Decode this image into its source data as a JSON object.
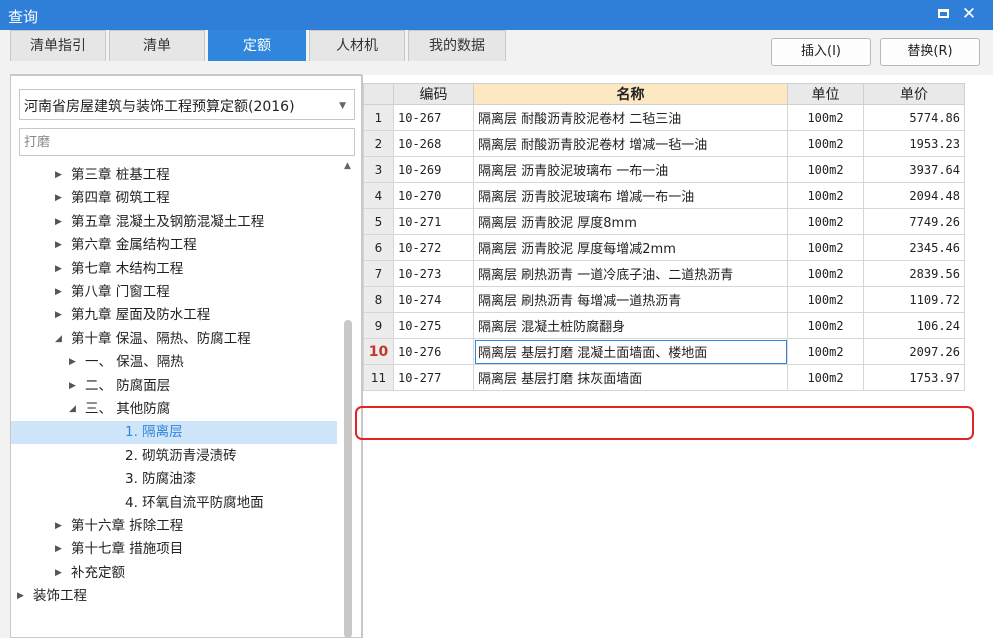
{
  "window": {
    "title": "查询"
  },
  "tabs": [
    "清单指引",
    "清单",
    "定额",
    "人材机",
    "我的数据"
  ],
  "active_tab": 2,
  "buttons": {
    "insert": "插入(I)",
    "replace": "替换(R)"
  },
  "quota_select": {
    "value": "河南省房屋建筑与装饰工程预算定额(2016)"
  },
  "search": {
    "placeholder": "打磨"
  },
  "tree": [
    {
      "label": "第三章 桩基工程",
      "level": 1,
      "expanded": false
    },
    {
      "label": "第四章 砌筑工程",
      "level": 1,
      "expanded": false
    },
    {
      "label": "第五章 混凝土及钢筋混凝土工程",
      "level": 1,
      "expanded": false
    },
    {
      "label": "第六章 金属结构工程",
      "level": 1,
      "expanded": false
    },
    {
      "label": "第七章 木结构工程",
      "level": 1,
      "expanded": false
    },
    {
      "label": "第八章 门窗工程",
      "level": 1,
      "expanded": false
    },
    {
      "label": "第九章 屋面及防水工程",
      "level": 1,
      "expanded": false
    },
    {
      "label": "第十章 保温、隔热、防腐工程",
      "level": 1,
      "expanded": true
    },
    {
      "label": "一、  保温、隔热",
      "level": 2,
      "expanded": false
    },
    {
      "label": "二、  防腐面层",
      "level": 2,
      "expanded": false
    },
    {
      "label": "三、  其他防腐",
      "level": 2,
      "expanded": true
    },
    {
      "label": "1. 隔离层",
      "level": 3,
      "leaf": true,
      "selected": true
    },
    {
      "label": "2. 砌筑沥青浸渍砖",
      "level": 3,
      "leaf": true
    },
    {
      "label": "3. 防腐油漆",
      "level": 3,
      "leaf": true
    },
    {
      "label": "4. 环氧自流平防腐地面",
      "level": 3,
      "leaf": true
    },
    {
      "label": "第十六章 拆除工程",
      "level": 1,
      "expanded": false
    },
    {
      "label": "第十七章 措施项目",
      "level": 1,
      "expanded": false
    },
    {
      "label": "补充定额",
      "level": 1,
      "expanded": false
    },
    {
      "label": "装饰工程",
      "level": 0,
      "expanded": false
    }
  ],
  "table": {
    "headers": {
      "code": "编码",
      "name": "名称",
      "unit": "单位",
      "price": "单价"
    },
    "selected_row": 9,
    "rows": [
      {
        "num": "1",
        "code": "10-267",
        "name": "隔离层 耐酸沥青胶泥卷材 二毡三油",
        "unit": "100m2",
        "price": "5774.86"
      },
      {
        "num": "2",
        "code": "10-268",
        "name": "隔离层 耐酸沥青胶泥卷材 增减一毡一油",
        "unit": "100m2",
        "price": "1953.23"
      },
      {
        "num": "3",
        "code": "10-269",
        "name": "隔离层 沥青胶泥玻璃布 一布一油",
        "unit": "100m2",
        "price": "3937.64"
      },
      {
        "num": "4",
        "code": "10-270",
        "name": "隔离层 沥青胶泥玻璃布 增减一布一油",
        "unit": "100m2",
        "price": "2094.48"
      },
      {
        "num": "5",
        "code": "10-271",
        "name": "隔离层 沥青胶泥 厚度8mm",
        "unit": "100m2",
        "price": "7749.26"
      },
      {
        "num": "6",
        "code": "10-272",
        "name": "隔离层 沥青胶泥 厚度每增减2mm",
        "unit": "100m2",
        "price": "2345.46"
      },
      {
        "num": "7",
        "code": "10-273",
        "name": "隔离层 刷热沥青 一道冷底子油、二道热沥青",
        "unit": "100m2",
        "price": "2839.56"
      },
      {
        "num": "8",
        "code": "10-274",
        "name": "隔离层 刷热沥青 每增减一道热沥青",
        "unit": "100m2",
        "price": "1109.72"
      },
      {
        "num": "9",
        "code": "10-275",
        "name": "隔离层 混凝土桩防腐翻身",
        "unit": "100m2",
        "price": "106.24"
      },
      {
        "num": "10",
        "code": "10-276",
        "name": "隔离层 基层打磨 混凝土面墙面、楼地面",
        "unit": "100m2",
        "price": "2097.26"
      },
      {
        "num": "11",
        "code": "10-277",
        "name": "隔离层 基层打磨 抹灰面墙面",
        "unit": "100m2",
        "price": "1753.97"
      }
    ]
  }
}
